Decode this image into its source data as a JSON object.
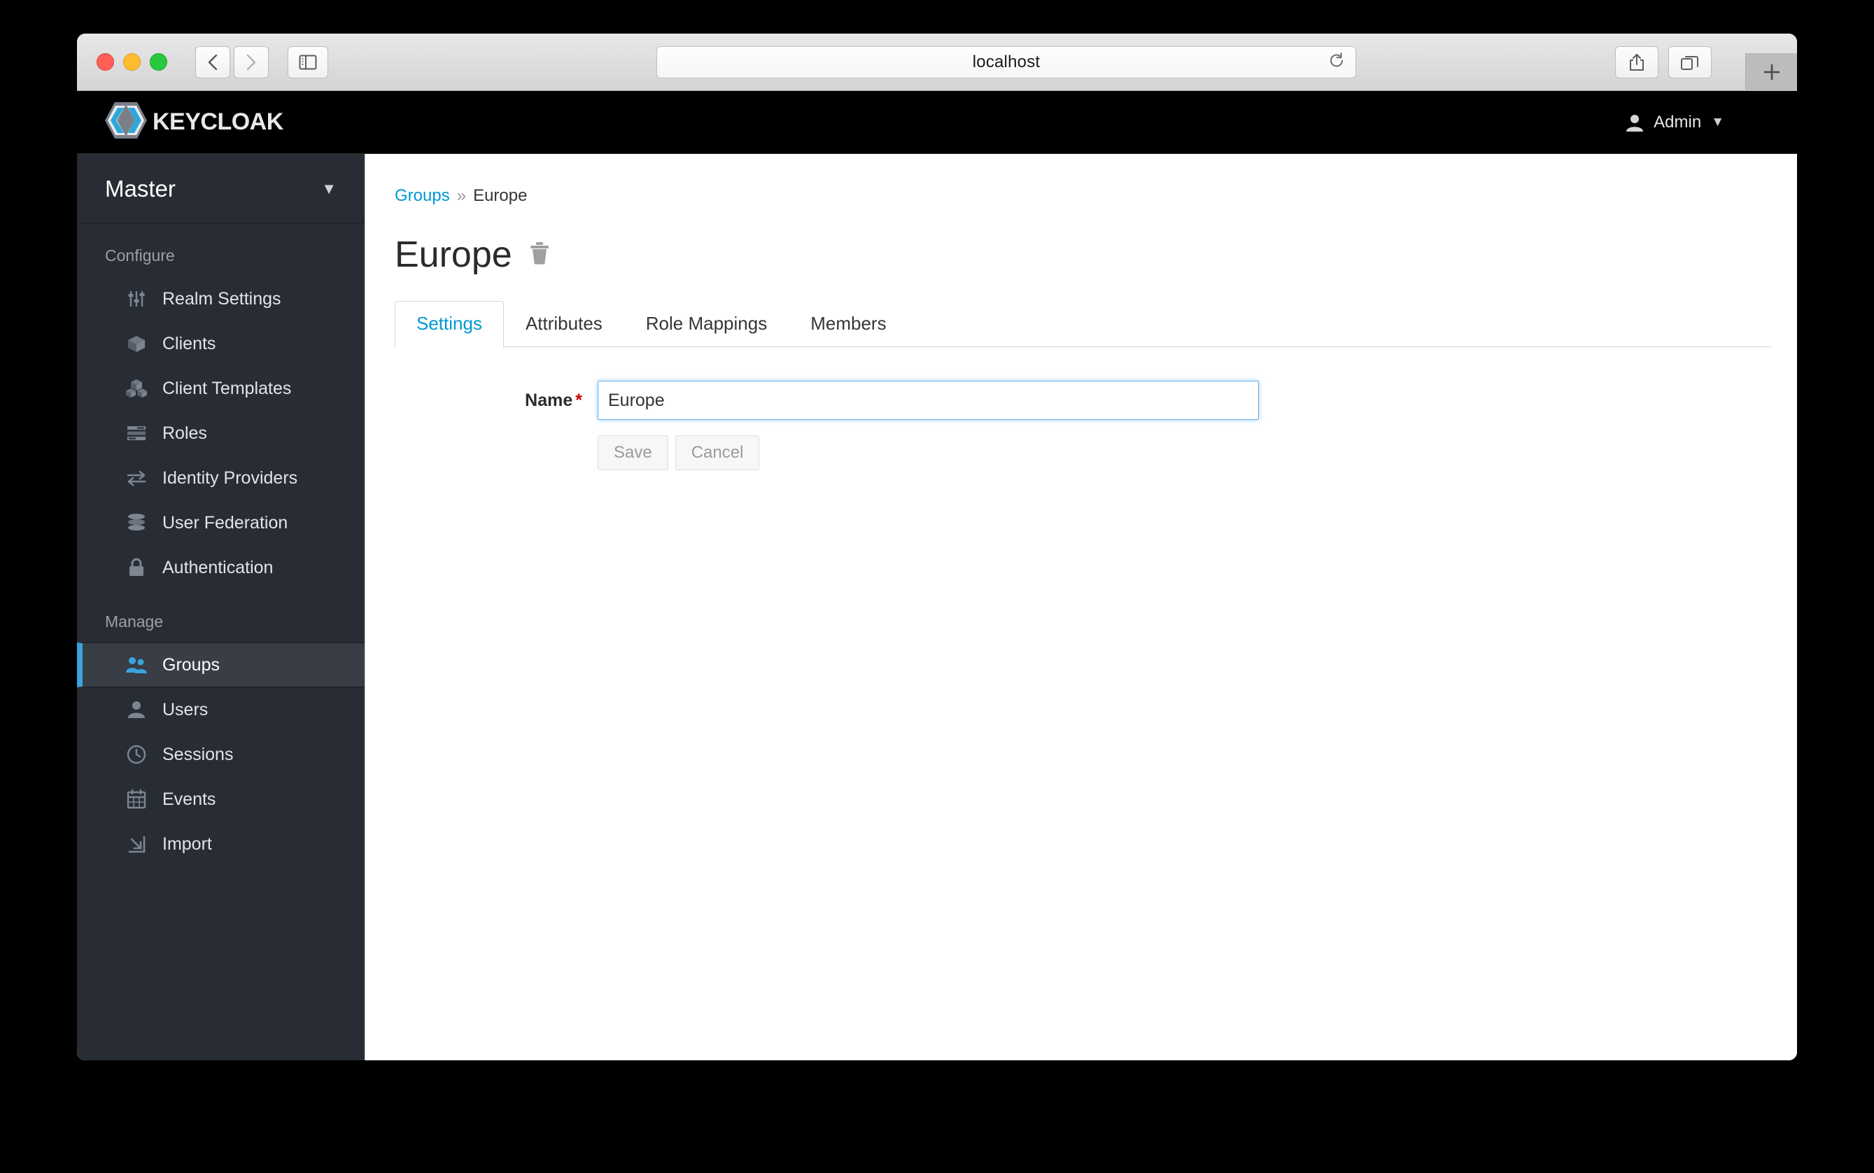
{
  "browser": {
    "url": "localhost",
    "back_label": "Back",
    "forward_label": "Forward",
    "sidebar_label": "Show Sidebar",
    "share_label": "Share",
    "tabs_label": "Show Tab Overview",
    "new_tab_label": "+"
  },
  "header": {
    "logo_text": "KEYCLOAK",
    "user_name": "Admin"
  },
  "sidebar": {
    "realm": "Master",
    "sections": [
      {
        "title": "Configure",
        "items": [
          {
            "label": "Realm Settings",
            "icon": "sliders-icon",
            "active": false
          },
          {
            "label": "Clients",
            "icon": "cube-icon",
            "active": false
          },
          {
            "label": "Client Templates",
            "icon": "cubes-icon",
            "active": false
          },
          {
            "label": "Roles",
            "icon": "list-icon",
            "active": false
          },
          {
            "label": "Identity Providers",
            "icon": "exchange-icon",
            "active": false
          },
          {
            "label": "User Federation",
            "icon": "database-icon",
            "active": false
          },
          {
            "label": "Authentication",
            "icon": "lock-icon",
            "active": false
          }
        ]
      },
      {
        "title": "Manage",
        "items": [
          {
            "label": "Groups",
            "icon": "users-group-icon",
            "active": true
          },
          {
            "label": "Users",
            "icon": "user-icon",
            "active": false
          },
          {
            "label": "Sessions",
            "icon": "clock-icon",
            "active": false
          },
          {
            "label": "Events",
            "icon": "calendar-icon",
            "active": false
          },
          {
            "label": "Import",
            "icon": "import-icon",
            "active": false
          }
        ]
      }
    ]
  },
  "main": {
    "breadcrumb": {
      "parent": "Groups",
      "separator": "»",
      "current": "Europe"
    },
    "page_title": "Europe",
    "delete_label": "Delete this group",
    "tabs": [
      {
        "label": "Settings",
        "active": true
      },
      {
        "label": "Attributes",
        "active": false
      },
      {
        "label": "Role Mappings",
        "active": false
      },
      {
        "label": "Members",
        "active": false
      }
    ],
    "form": {
      "name_label": "Name",
      "required_mark": "*",
      "name_value": "Europe",
      "name_placeholder": "",
      "save_label": "Save",
      "cancel_label": "Cancel"
    }
  },
  "colors": {
    "accent_blue": "#0099d3",
    "sidebar_bg": "#282d35",
    "sidebar_active_bg": "#383d46",
    "active_border": "#39a5dc",
    "header_bg": "#000000",
    "required_red": "#cc0000",
    "focus_blue": "#66afe9"
  }
}
